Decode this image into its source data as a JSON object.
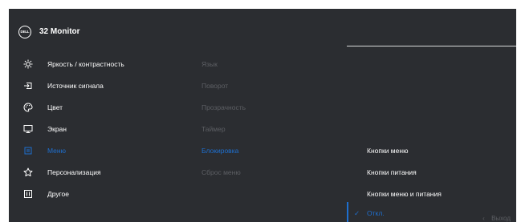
{
  "header": {
    "brand": "DELL",
    "title": "32 Monitor"
  },
  "main_menu": [
    {
      "label": "Яркость / контрастность",
      "icon": "brightness-icon",
      "active": false
    },
    {
      "label": "Источник сигнала",
      "icon": "input-source-icon",
      "active": false
    },
    {
      "label": "Цвет",
      "icon": "color-palette-icon",
      "active": false
    },
    {
      "label": "Экран",
      "icon": "display-icon",
      "active": false
    },
    {
      "label": "Меню",
      "icon": "menu-icon",
      "active": true
    },
    {
      "label": "Персонализация",
      "icon": "star-icon",
      "active": false
    },
    {
      "label": "Другое",
      "icon": "other-icon",
      "active": false
    }
  ],
  "sub_menu": [
    {
      "label": "Язык",
      "active": false
    },
    {
      "label": "Поворот",
      "active": false
    },
    {
      "label": "Прозрачность",
      "active": false
    },
    {
      "label": "Таймер",
      "active": false
    },
    {
      "label": "Блокировка",
      "active": true
    },
    {
      "label": "Сброс меню",
      "active": false
    }
  ],
  "options": [
    {
      "label": "Кнопки меню",
      "selected": false
    },
    {
      "label": "Кнопки питания",
      "selected": false
    },
    {
      "label": "Кнопки меню и питания",
      "selected": false
    },
    {
      "label": "Откл.",
      "selected": true
    }
  ],
  "footer": {
    "back_arrow": "‹",
    "back_label": "Выход"
  },
  "colors": {
    "background": "#2b2d31",
    "accent": "#1e6fcf",
    "text": "#ffffff",
    "disabled_text": "#5d5f64"
  }
}
